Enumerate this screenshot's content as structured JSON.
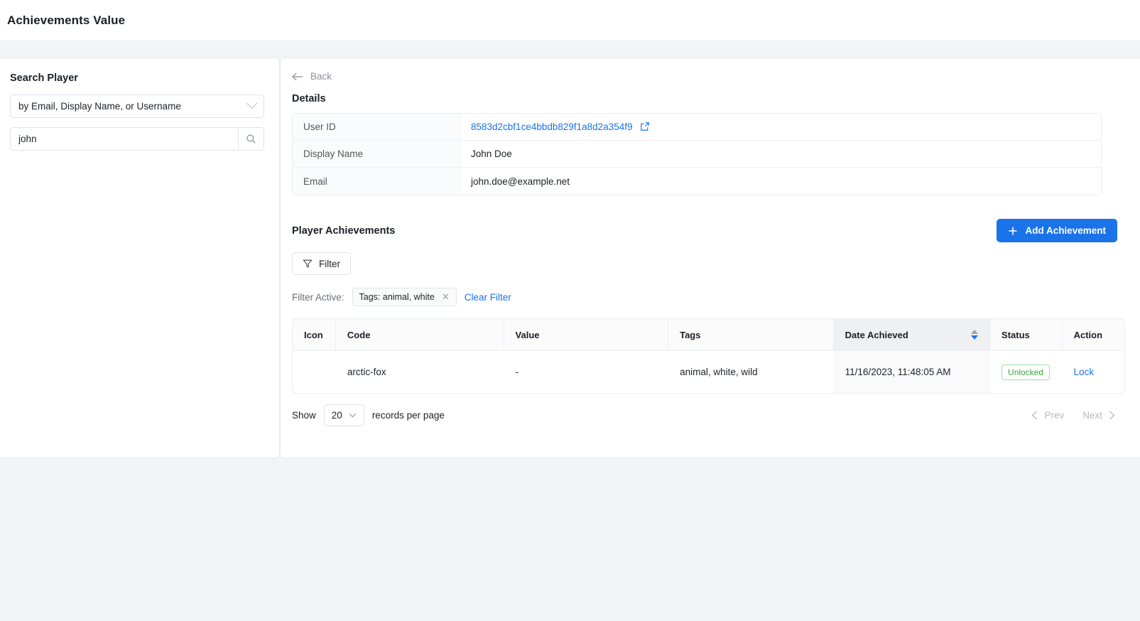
{
  "app": {
    "title": "Achievements Value"
  },
  "sidebar": {
    "title": "Search Player",
    "mode_select": {
      "value": "by Email, Display Name, or Username",
      "chevron_icon": "chevron-down-icon"
    },
    "search": {
      "value": "john",
      "placeholder": "",
      "button_icon": "search-icon"
    }
  },
  "main": {
    "back": {
      "label": "Back",
      "icon": "arrow-left-icon"
    },
    "details": {
      "title": "Details",
      "rows": [
        {
          "key": "User ID",
          "value": "8583d2cbf1ce4bbdb829f1a8d2a354f9",
          "is_link": true,
          "external_icon": "external-link-icon"
        },
        {
          "key": "Display Name",
          "value": "John Doe",
          "is_link": false
        },
        {
          "key": "Email",
          "value": "john.doe@example.net",
          "is_link": false
        }
      ]
    },
    "achievements": {
      "title": "Player Achievements",
      "add_button": {
        "label": "Add Achievement",
        "icon": "plus-icon",
        "color": "#1a73e8"
      },
      "filter_button": {
        "label": "Filter",
        "icon": "filter-icon"
      },
      "filter_active": {
        "label": "Filter Active:",
        "chip": {
          "text": "Tags: animal, white",
          "remove_icon": "close-icon"
        },
        "clear_label": "Clear Filter"
      },
      "table": {
        "columns": [
          {
            "label": "Icon",
            "sorted": false
          },
          {
            "label": "Code",
            "sorted": false
          },
          {
            "label": "Value",
            "sorted": false
          },
          {
            "label": "Tags",
            "sorted": false
          },
          {
            "label": "Date Achieved",
            "sorted": true,
            "sort_icon": "sort-arrows-icon",
            "sort_direction": "desc"
          },
          {
            "label": "Status",
            "sorted": false
          },
          {
            "label": "Action",
            "sorted": false
          }
        ],
        "rows": [
          {
            "icon_color": "#27ae52",
            "code": "arctic-fox",
            "value": "-",
            "tags": "animal, white, wild",
            "date_achieved": "11/16/2023, 11:48:05 AM",
            "status": "Unlocked",
            "action": "Lock"
          }
        ]
      },
      "footer": {
        "show_label": "Show",
        "page_size": "20",
        "page_size_chevron": "chevron-down-icon",
        "records_label": "records per page",
        "prev_label": "Prev",
        "next_label": "Next",
        "prev_icon": "chevron-left-icon",
        "next_icon": "chevron-right-icon"
      }
    }
  }
}
